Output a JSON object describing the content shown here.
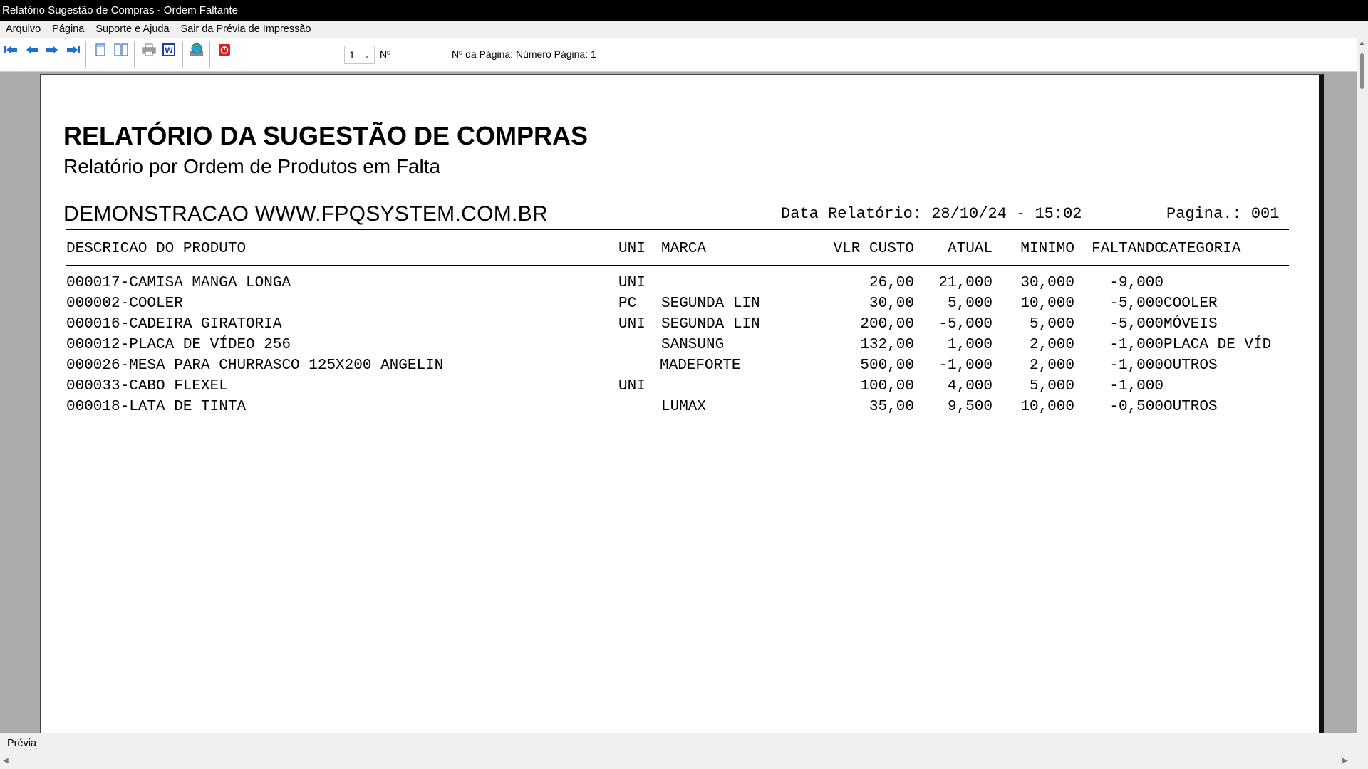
{
  "window": {
    "title": "Relatório Sugestão de Compras - Ordem Faltante"
  },
  "menu": [
    {
      "label": "Arquivo"
    },
    {
      "label": "Página"
    },
    {
      "label": "Suporte e Ajuda"
    },
    {
      "label": "Sair da Prévia de Impressão"
    }
  ],
  "toolbar": {
    "page_select_value": "1",
    "page_no_label": "Nº",
    "page_info": "Nº da Página: Número Página: 1",
    "icons": [
      "first-page-icon",
      "prev-page-icon",
      "next-page-icon",
      "last-page-icon",
      "single-page-icon",
      "two-pages-icon",
      "print-icon",
      "export-word-icon",
      "export-web-icon",
      "close-preview-icon"
    ],
    "icon_colors": {
      "arrows": "#1e6fd0",
      "word": "#1f3da8",
      "close": "#d92020"
    }
  },
  "report": {
    "title": "RELATÓRIO DA SUGESTÃO DE COMPRAS",
    "subtitle": "Relatório por Ordem de Produtos em Falta",
    "company": "DEMONSTRACAO WWW.FPQSYSTEM.COM.BR",
    "date_label": "Data Relatório: 28/10/24 - 15:02",
    "page_label": "Pagina.: 001",
    "columns": {
      "descricao": "DESCRICAO DO PRODUTO",
      "uni": "UNI",
      "marca": "MARCA",
      "vlr_custo": "VLR CUSTO",
      "atual": "ATUAL",
      "minimo": "MINIMO",
      "faltando": "FALTANDO",
      "categoria": "CATEGORIA"
    },
    "rows": [
      {
        "descricao": "000017-CAMISA MANGA LONGA",
        "uni": "UNI",
        "marca": "",
        "vlr_custo": "26,00",
        "atual": "21,000",
        "minimo": "30,000",
        "faltando": "-9,000",
        "categoria": ""
      },
      {
        "descricao": "000002-COOLER",
        "uni": "PC",
        "marca": "SEGUNDA LIN",
        "vlr_custo": "30,00",
        "atual": "5,000",
        "minimo": "10,000",
        "faltando": "-5,000",
        "categoria": "COOLER"
      },
      {
        "descricao": "000016-CADEIRA GIRATORIA",
        "uni": "UNI",
        "marca": "SEGUNDA LIN",
        "vlr_custo": "200,00",
        "atual": "-5,000",
        "minimo": "5,000",
        "faltando": "-5,000",
        "categoria": "MÓVEIS"
      },
      {
        "descricao": "000012-PLACA DE VÍDEO 256",
        "uni": "",
        "marca": "SANSUNG",
        "vlr_custo": "132,00",
        "atual": "1,000",
        "minimo": "2,000",
        "faltando": "-1,000",
        "categoria": "PLACA DE VÍD"
      },
      {
        "descricao": "000026-MESA PARA CHURRASCO 125X200 ANGELIN",
        "uni": "",
        "marca": "MADEFORTE",
        "vlr_custo": "500,00",
        "atual": "-1,000",
        "minimo": "2,000",
        "faltando": "-1,000",
        "categoria": "OUTROS"
      },
      {
        "descricao": "000033-CABO FLEXEL",
        "uni": "UNI",
        "marca": "",
        "vlr_custo": "100,00",
        "atual": "4,000",
        "minimo": "5,000",
        "faltando": "-1,000",
        "categoria": ""
      },
      {
        "descricao": "000018-LATA DE TINTA",
        "uni": "",
        "marca": "LUMAX",
        "vlr_custo": "35,00",
        "atual": "9,500",
        "minimo": "10,000",
        "faltando": "-0,500",
        "categoria": "OUTROS"
      }
    ]
  },
  "status": {
    "text": "Prévia"
  }
}
